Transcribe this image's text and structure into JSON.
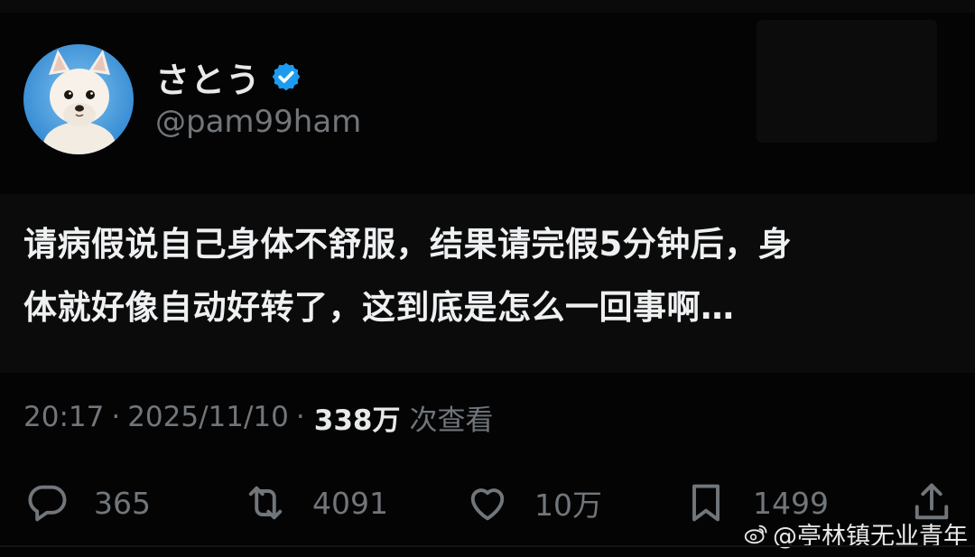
{
  "profile": {
    "display_name": "さとう",
    "handle": "@pam99ham",
    "verified": true,
    "avatar_icon": "chihuahua-avatar"
  },
  "tweet": {
    "text_line1": "请病假说自己身体不舒服，结果请完假5分钟后，身",
    "text_line2": "体就好像自动好转了，这到底是怎么一回事啊…"
  },
  "meta": {
    "time": "20:17",
    "sep1": "·",
    "date": "2025/11/10",
    "sep2": "·",
    "views": "338万",
    "views_label": "次查看"
  },
  "actions": {
    "reply_count": "365",
    "retweet_count": "4091",
    "like_count": "10万",
    "bookmark_count": "1499"
  },
  "watermark": {
    "text": "@亭林镇无业青年"
  },
  "colors": {
    "background": "#000000",
    "text": "#e7e9ea",
    "muted": "#71767b",
    "verified_blue": "#1d9bf0"
  }
}
